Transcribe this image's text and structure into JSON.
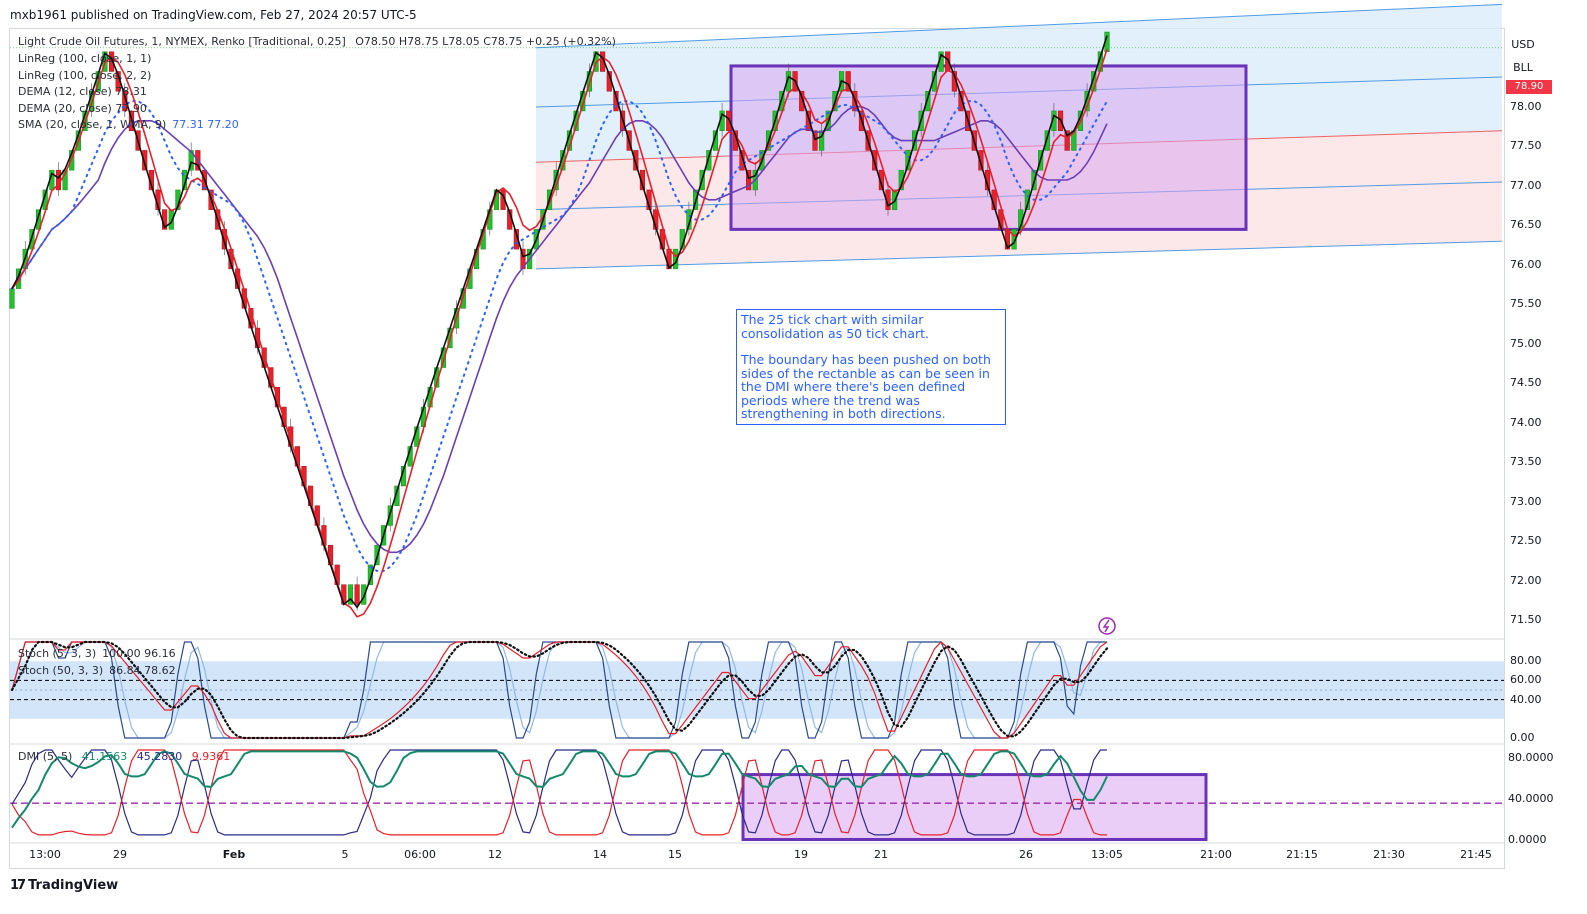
{
  "header": {
    "published": "mxb1961 published on TradingView.com, Feb 27, 2024 20:57 UTC-5"
  },
  "symbol_line": {
    "name": "Light Crude Oil Futures, 1, NYMEX, Renko [Traditional, 0.25]",
    "ohlc": "O78.50  H78.75  L78.05  C78.75  +0.25 (+0.32%)"
  },
  "legend_main": [
    {
      "label": "LinReg (100, close, 1, 1)",
      "value": ""
    },
    {
      "label": "LinReg (100, close, 2, 2)",
      "value": ""
    },
    {
      "label": "DEMA (12, close) 78.31",
      "value": ""
    },
    {
      "label": "DEMA (20, close) 77.90",
      "value": ""
    },
    {
      "label": "SMA (20, close, 1, WMA, 9)",
      "value": "77.31  77.20"
    }
  ],
  "legend_stoch": [
    {
      "label": "Stoch (5, 3, 3)",
      "value": "100.00  96.16"
    },
    {
      "label": "Stoch (50, 3, 3)",
      "value": "86.84  78.62"
    }
  ],
  "legend_dmi": {
    "label": "DMI (5, 5)",
    "plus": "41.1563",
    "minus": "45.2830",
    "adx": "9.9361"
  },
  "units": {
    "currency": "USD",
    "unit": "BLL"
  },
  "last_price_flag": "78.90",
  "note": {
    "para1": "The 25 tick chart with similar consolidation as 50 tick chart.",
    "para2": "The boundary has been pushed on both sides of the rectanble as can be seen in the DMI where there's been defined periods where the trend was strengthening in both directions."
  },
  "footer": {
    "brand": "TradingView"
  },
  "colors": {
    "up": "#22c02a",
    "down": "#e8202a",
    "dema12": "#111111",
    "dema20": "#e8202a",
    "sma": "#6a3fb5",
    "wma": "#2962ff",
    "rect": "#6a32b8",
    "rect_fill": "#d8a6f0",
    "linreg": "#4e9be6",
    "plus_di": "#2a2a8c",
    "minus_di": "#e8202a",
    "adx": "#138a6c"
  },
  "chart_data": [
    {
      "type": "renko",
      "ylim": [
        71.3,
        78.95
      ],
      "y_ticks": [
        "78.00",
        "77.50",
        "77.00",
        "76.50",
        "76.00",
        "75.50",
        "75.00",
        "74.50",
        "74.00",
        "73.50",
        "73.00",
        "72.50",
        "72.00",
        "71.50"
      ],
      "x_ticks": [
        "13:00",
        "29",
        "Feb",
        "5",
        "06:00",
        "12",
        "14",
        "15",
        "19",
        "21",
        "26",
        "13:05",
        "21:00",
        "21:15",
        "21:30",
        "21:45"
      ],
      "brick_size": 0.25,
      "bricks": [
        75.7,
        75.95,
        76.2,
        76.45,
        76.7,
        76.95,
        77.2,
        76.95,
        77.2,
        77.45,
        77.7,
        77.95,
        78.2,
        78.45,
        78.7,
        78.45,
        78.2,
        77.95,
        77.7,
        77.45,
        77.2,
        76.95,
        76.7,
        76.45,
        76.7,
        76.95,
        77.2,
        77.45,
        77.2,
        76.95,
        76.7,
        76.45,
        76.2,
        75.95,
        75.7,
        75.45,
        75.2,
        74.95,
        74.7,
        74.45,
        74.2,
        73.95,
        73.7,
        73.45,
        73.2,
        72.95,
        72.7,
        72.45,
        72.2,
        71.95,
        71.7,
        71.95,
        71.7,
        71.95,
        72.2,
        72.45,
        72.7,
        72.95,
        73.2,
        73.45,
        73.7,
        73.95,
        74.2,
        74.45,
        74.7,
        74.95,
        75.2,
        75.45,
        75.7,
        75.95,
        76.2,
        76.45,
        76.7,
        76.95,
        76.7,
        76.45,
        76.2,
        75.95,
        76.2,
        76.45,
        76.7,
        76.95,
        77.2,
        77.45,
        77.7,
        77.95,
        78.2,
        78.45,
        78.7,
        78.45,
        78.2,
        77.95,
        77.7,
        77.45,
        77.2,
        76.95,
        76.7,
        76.45,
        76.2,
        75.95,
        76.2,
        76.45,
        76.7,
        76.95,
        77.2,
        77.45,
        77.7,
        77.95,
        77.7,
        77.45,
        77.2,
        76.95,
        77.2,
        77.45,
        77.7,
        77.95,
        78.2,
        78.45,
        78.2,
        77.95,
        77.7,
        77.45,
        77.7,
        77.95,
        78.2,
        78.45,
        78.2,
        77.95,
        77.7,
        77.45,
        77.2,
        76.95,
        76.7,
        76.95,
        77.2,
        77.45,
        77.7,
        77.95,
        78.2,
        78.45,
        78.7,
        78.45,
        78.2,
        77.95,
        77.7,
        77.45,
        77.2,
        76.95,
        76.7,
        76.45,
        76.2,
        76.45,
        76.7,
        76.95,
        77.2,
        77.45,
        77.7,
        77.95,
        77.7,
        77.45,
        77.7,
        77.95,
        78.2,
        78.45,
        78.7,
        78.95
      ]
    },
    {
      "type": "line",
      "title": "",
      "ylim": [
        0,
        100
      ],
      "y_ticks": [
        "80.00",
        "60.00",
        "40.00",
        "0.00"
      ]
    },
    {
      "type": "line",
      "title": "",
      "ylim": [
        0,
        90
      ],
      "y_ticks": [
        "80.0000",
        "40.0000",
        "0.0000"
      ]
    }
  ]
}
